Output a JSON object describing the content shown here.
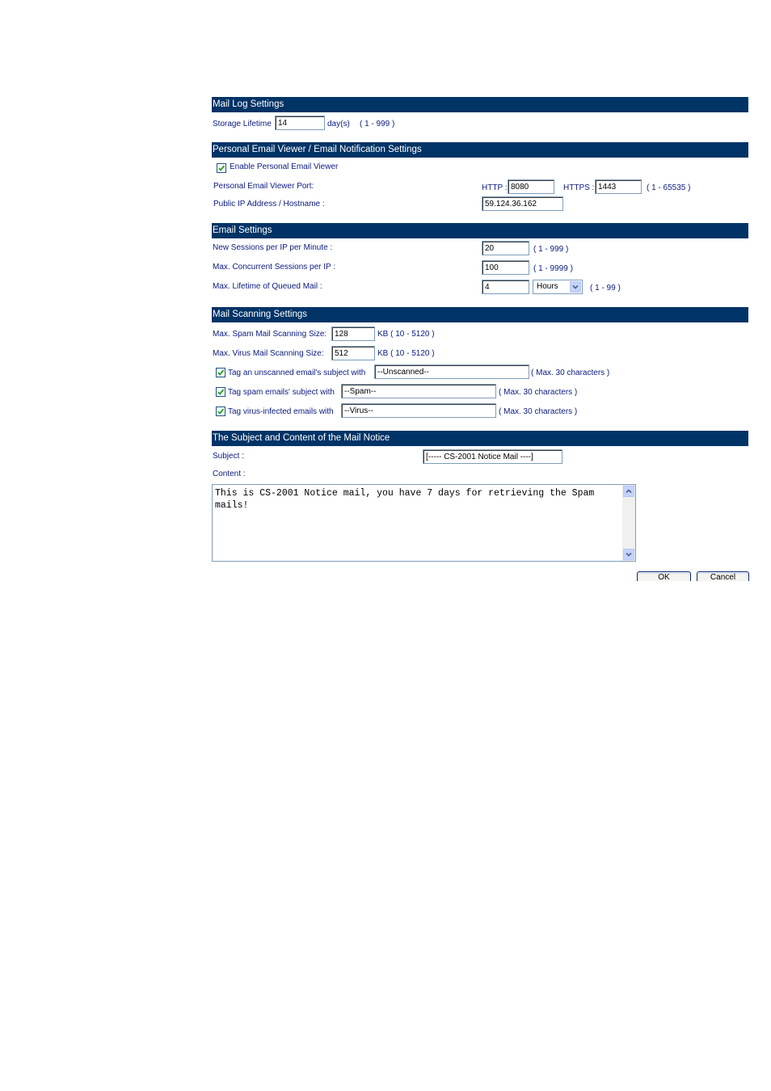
{
  "mail_log": {
    "title": "Mail Log Settings",
    "storage_lifetime_label": "Storage Lifetime",
    "storage_lifetime_value": "14",
    "storage_lifetime_unit": "day(s)",
    "storage_lifetime_range": "( 1 - 999 )"
  },
  "viewer": {
    "title": "Personal Email Viewer / Email Notification Settings",
    "enable_label": "Enable Personal Email Viewer",
    "enable_checked": true,
    "port_label": "Personal Email Viewer Port:",
    "http_label": "HTTP :",
    "http_value": "8080",
    "https_label": "HTTPS :",
    "https_value": "1443",
    "port_range": "( 1 - 65535 )",
    "public_ip_label": "Public IP Address / Hostname :",
    "public_ip_value": "59.124.36.162"
  },
  "email": {
    "title": "Email Settings",
    "new_sessions_label": "New Sessions per IP per Minute :",
    "new_sessions_value": "20",
    "new_sessions_range": "( 1 - 999 )",
    "concurrent_label": "Max. Concurrent Sessions per IP :",
    "concurrent_value": "100",
    "concurrent_range": "( 1 - 9999 )",
    "queued_label": "Max. Lifetime of Queued Mail :",
    "queued_value": "4",
    "queued_unit": "Hours",
    "queued_range": "( 1 - 99 )"
  },
  "scanning": {
    "title": "Mail Scanning Settings",
    "spam_size_label": "Max. Spam Mail Scanning Size:",
    "spam_size_value": "128",
    "spam_size_range": "KB ( 10 - 5120 )",
    "virus_size_label": "Max. Virus Mail Scanning Size:",
    "virus_size_value": "512",
    "virus_size_range": "KB ( 10 - 5120 )",
    "tag_unscanned_label": "Tag an unscanned email's subject with",
    "tag_unscanned_value": "--Unscanned--",
    "tag_spam_label": "Tag spam emails' subject with",
    "tag_spam_value": "--Spam--",
    "tag_virus_label": "Tag virus-infected emails with",
    "tag_virus_value": "--Virus--",
    "max_chars": "( Max. 30 characters )"
  },
  "notice": {
    "title": "The Subject and Content of the Mail Notice",
    "subject_label": "Subject :",
    "subject_value": "[----- CS-2001 Notice Mail ----]",
    "content_label": "Content :",
    "content_value": "This is CS-2001 Notice mail, you have 7 days for retrieving the Spam mails!"
  },
  "buttons": {
    "ok": "OK",
    "cancel": "Cancel"
  },
  "icons": {
    "check": "checkmark-icon",
    "dropdown": "chevron-down-icon",
    "scroll_up": "scroll-up-icon",
    "scroll_down": "scroll-down-icon"
  },
  "colors": {
    "header_bar": "#003366",
    "label_text": "#0a1a80",
    "check_green": "#21a121"
  }
}
